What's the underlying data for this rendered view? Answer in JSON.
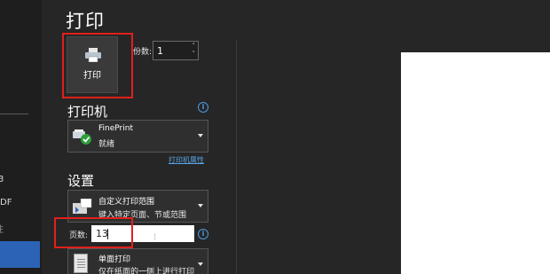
{
  "title": "打印",
  "print_button": {
    "label": "打印",
    "icon": "printer-icon"
  },
  "copies": {
    "label": "份数:",
    "value": "1",
    "spin_up": "˄",
    "spin_down": "˅"
  },
  "printer": {
    "heading": "打印机",
    "info_icon": "i",
    "name": "FinePrint",
    "status": "就绪",
    "status_icon": "check-icon",
    "properties_link": "打印机属性"
  },
  "settings": {
    "heading": "设置",
    "range": {
      "title": "自定义打印范围",
      "subtitle": "键入特定页面、节或范围"
    },
    "pages": {
      "label": "页数:",
      "value": "13",
      "info_icon": "i",
      "cursor_glyph": "I"
    },
    "sided": {
      "title": "单面打印",
      "subtitle": "仅在纸面的一侧上进行打印"
    }
  },
  "left_nav": {
    "fragment_1": "3",
    "fragment_2": "PDF",
    "fragment_3": "注"
  },
  "colors": {
    "background": "#262626",
    "highlight_box": "#e0201c",
    "link": "#5aa3e6",
    "accent": "#2d63b6"
  }
}
